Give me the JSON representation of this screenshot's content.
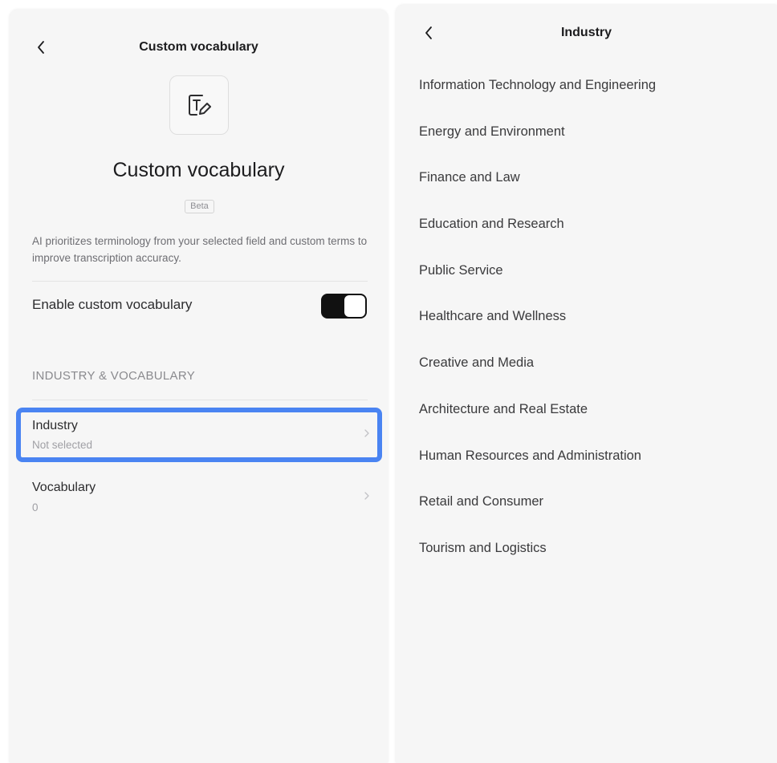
{
  "left_panel": {
    "title": "Custom vocabulary",
    "hero_title": "Custom vocabulary",
    "badge": "Beta",
    "description": "AI prioritizes terminology from your selected field and custom terms to improve transcription accuracy.",
    "toggle": {
      "label": "Enable custom vocabulary",
      "state": "on"
    },
    "section_header": "INDUSTRY & VOCABULARY",
    "rows": [
      {
        "title": "Industry",
        "subtitle": "Not selected",
        "highlighted": true
      },
      {
        "title": "Vocabulary",
        "subtitle": "0"
      }
    ],
    "highlight_color": "#4a84f2"
  },
  "right_panel": {
    "title": "Industry",
    "items": [
      "Information Technology and Engineering",
      "Energy and Environment",
      "Finance and Law",
      "Education and Research",
      "Public Service",
      "Healthcare and Wellness",
      "Creative and Media",
      "Architecture and Real Estate",
      "Human Resources and Administration",
      "Retail and Consumer",
      "Tourism and Logistics"
    ]
  }
}
